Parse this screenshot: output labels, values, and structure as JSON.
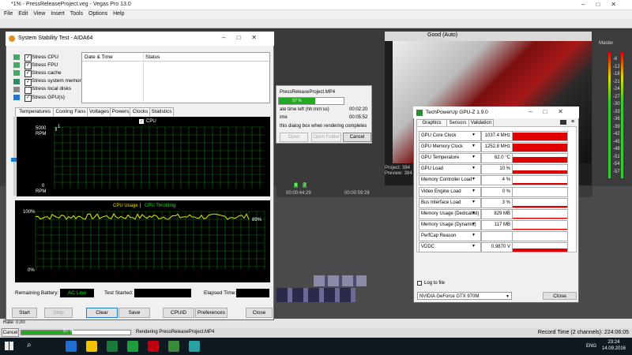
{
  "vegas": {
    "title": "*1% - PressReleaseProject.veg - Vegas Pro 13.0",
    "menu": [
      "File",
      "Edit",
      "View",
      "Insert",
      "Tools",
      "Options",
      "Help"
    ],
    "preview_quality": "Good (Auto)",
    "master_label": "Master",
    "master_levels": [
      "-6",
      "-12",
      "-18",
      "-21",
      "-24",
      "-27",
      "-30",
      "-33",
      "-36",
      "-39",
      "-42",
      "-45",
      "-48",
      "-51",
      "-54",
      "-57"
    ],
    "project_label": "Project: 384",
    "preview_label": "Preview: 384",
    "timecodes": [
      "00:00:44:29",
      "00:00:59:28"
    ],
    "markers": [
      "6",
      "7"
    ],
    "rate": "Rate: 0,00",
    "status_left": "Rendering PressReleaseProject.MP4",
    "render_pct": "57 %",
    "status_right": "Record Time (2 channels): 224:06:05",
    "cancel": "Cancel"
  },
  "render_dialog": {
    "file": "PressReleaseProject.MP4",
    "pct": "57 %",
    "time_left_label": "ate time left (hh:mm:ss)",
    "time_left": "00:02:20",
    "time_label": "ime",
    "time": "00:05:52",
    "close_text": "this dialog box when rendering completes",
    "open": "Open",
    "open_folder": "Open Folder",
    "cancel": "Cancel"
  },
  "aida": {
    "title": "System Stability Test - AIDA64",
    "checks": [
      {
        "label": "Stress CPU",
        "checked": true
      },
      {
        "label": "Stress FPU",
        "checked": true
      },
      {
        "label": "Stress cache",
        "checked": true
      },
      {
        "label": "Stress system memory",
        "checked": true
      },
      {
        "label": "Stress local disks",
        "checked": false
      },
      {
        "label": "Stress GPU(s)",
        "checked": true
      }
    ],
    "log_headers": {
      "date": "Date & Time",
      "status": "Status"
    },
    "tabs": [
      "Temperatures",
      "Cooling Fans",
      "Voltages",
      "Powers",
      "Clocks",
      "Statistics"
    ],
    "fan_graph": {
      "legend": "CPU",
      "ymax": "5000",
      "ymax_unit": "RPM",
      "ymin": "0",
      "ymin_unit": "RPM",
      "value": "1"
    },
    "cpu_graph": {
      "title_a": "CPU Usage",
      "sep": "|",
      "title_b": "CPU Throttling",
      "ymax": "100%",
      "ymin": "0%",
      "value": "89%"
    },
    "status_labels": {
      "battery": "Remaining Battery:",
      "battery_value": "AC Line",
      "started": "Test Started:",
      "elapsed": "Elapsed Time:"
    },
    "buttons": [
      "Start",
      "Stop",
      "Clear",
      "Save",
      "CPUID",
      "Preferences",
      "Close"
    ]
  },
  "gpuz": {
    "title": "TechPowerUp GPU-Z 1.9.0",
    "tabs": [
      "Graphics Card",
      "Sensors",
      "Validation"
    ],
    "sensors": [
      {
        "label": "GPU Core Clock",
        "value": "1037.4 MHz",
        "fill": 0.9
      },
      {
        "label": "GPU Memory Clock",
        "value": "1252.8 MHz",
        "fill": 0.9
      },
      {
        "label": "GPU Temperature",
        "value": "62.0 °C",
        "fill": 0.7
      },
      {
        "label": "GPU Load",
        "value": "10 %",
        "fill": 0.35
      },
      {
        "label": "Memory Controller Load",
        "value": "4 %",
        "fill": 0.2
      },
      {
        "label": "Video Engine Load",
        "value": "0 %",
        "fill": 0
      },
      {
        "label": "Bus Interface Load",
        "value": "3 %",
        "fill": 0.15
      },
      {
        "label": "Memory Usage (Dedicated)",
        "value": "829 MB",
        "fill": 0.1
      },
      {
        "label": "Memory Usage (Dynamic)",
        "value": "117 MB",
        "fill": 0.05
      },
      {
        "label": "PerfCap Reason",
        "value": "",
        "fill": 0
      },
      {
        "label": "VDDC",
        "value": "0.9870 V",
        "fill": 0.4
      }
    ],
    "log_to_file": "Log to file",
    "gpu_name": "NVIDIA GeForce GTX 970M",
    "close": "Close"
  },
  "taskbar": {
    "time": "23:24",
    "date": "14.09.2016",
    "lang": "ENG",
    "colors": [
      "#1f6fd0",
      "#f2c200",
      "#1a7a3a",
      "#1e9e3e",
      "#c00010",
      "#3a8a3a",
      "#2aa0a0"
    ]
  }
}
